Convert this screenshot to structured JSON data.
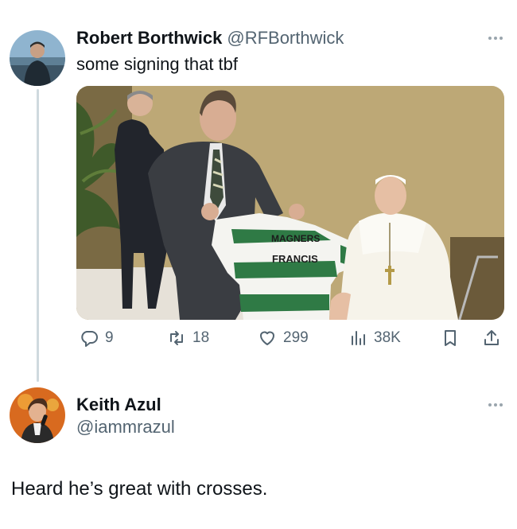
{
  "tweet1": {
    "author_name": "Robert Borthwick",
    "author_handle": "@RFBorthwick",
    "text": "some signing that tbf",
    "avatar_icon": "profile-photo",
    "media": {
      "jersey_sponsor": "MAGNERS",
      "jersey_name": "FRANCIS"
    },
    "stats": {
      "replies": "9",
      "retweets": "18",
      "likes": "299",
      "views": "38K"
    }
  },
  "tweet2": {
    "author_name": "Keith Azul",
    "author_handle": "@iammrazul",
    "text": "Heard he’s great with crosses.",
    "avatar_icon": "profile-photo"
  },
  "icons": {
    "reply": "reply-icon",
    "retweet": "retweet-icon",
    "like": "heart-icon",
    "views": "views-icon",
    "bookmark": "bookmark-icon",
    "share": "share-icon",
    "more": "more-icon"
  },
  "colors": {
    "text": "#0f1419",
    "secondary": "#536471",
    "thread_line": "#cfd9de"
  }
}
